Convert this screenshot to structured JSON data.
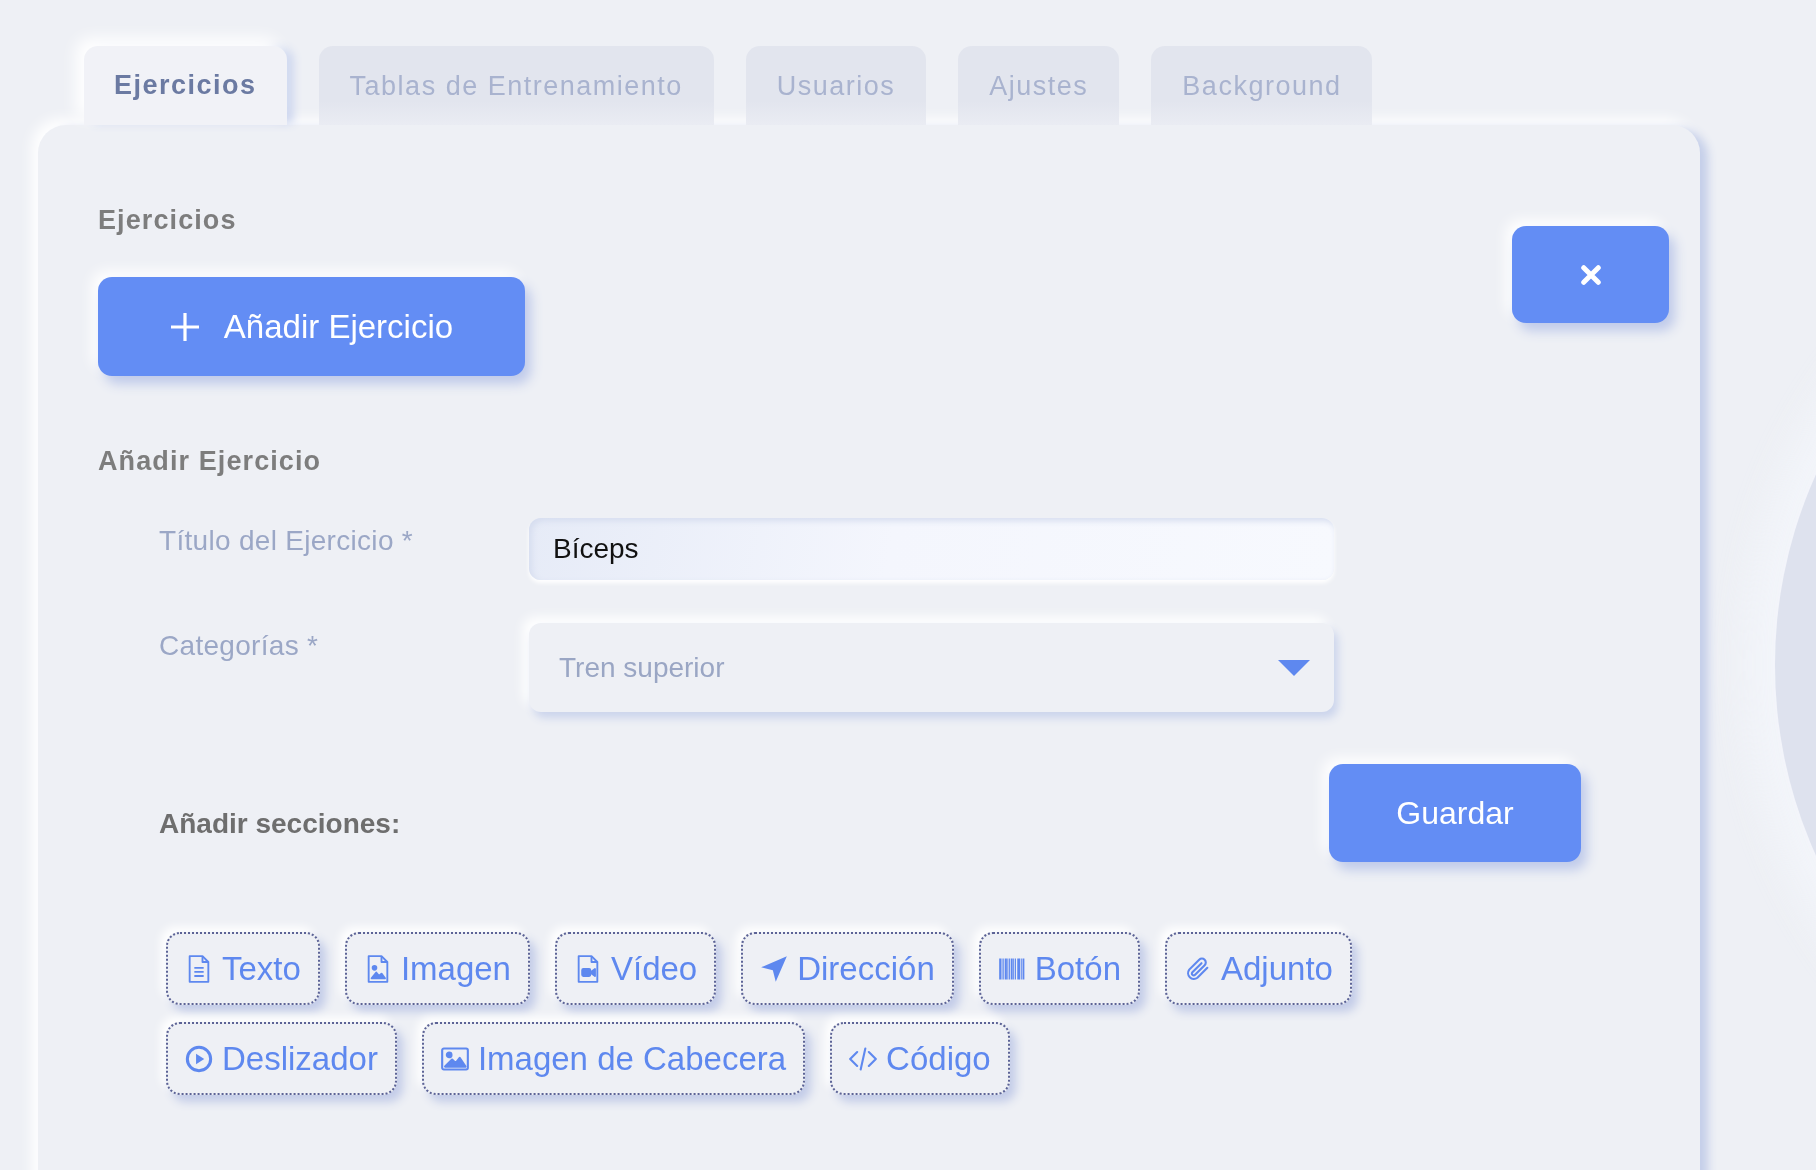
{
  "tabs": [
    {
      "label": "Ejercicios",
      "selected": true
    },
    {
      "label": "Tablas de Entrenamiento",
      "selected": false
    },
    {
      "label": "Usuarios",
      "selected": false
    },
    {
      "label": "Ajustes",
      "selected": false
    },
    {
      "label": "Background",
      "selected": false
    }
  ],
  "panel": {
    "heading": "Ejercicios",
    "add_button": "Añadir Ejercicio"
  },
  "form": {
    "heading": "Añadir Ejercicio",
    "fields": [
      {
        "kind": "text",
        "label": "Título del Ejercicio *",
        "value": "Bíceps"
      },
      {
        "kind": "select",
        "label": "Categorías *",
        "value": "Tren superior"
      }
    ]
  },
  "sections": {
    "label": "Añadir secciones:",
    "save_button": "Guardar",
    "buttons": [
      {
        "kind": "text",
        "label": "Texto"
      },
      {
        "kind": "image",
        "label": "Imagen"
      },
      {
        "kind": "video",
        "label": "Vídeo"
      },
      {
        "kind": "direction",
        "label": "Dirección"
      },
      {
        "kind": "button",
        "label": "Botón"
      },
      {
        "kind": "attachment",
        "label": "Adjunto"
      },
      {
        "kind": "slider",
        "label": "Deslizador"
      },
      {
        "kind": "header_image",
        "label": "Imagen de Cabecera"
      },
      {
        "kind": "code",
        "label": "Código"
      }
    ]
  }
}
